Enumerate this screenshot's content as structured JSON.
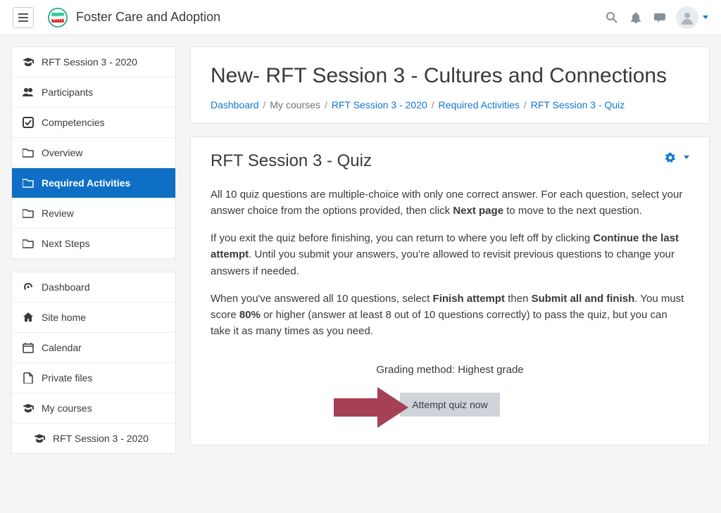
{
  "site_title": "Foster Care and Adoption",
  "sidebar": {
    "course_items": [
      {
        "icon": "grad-cap",
        "label": "RFT Session 3 - 2020",
        "active": false
      },
      {
        "icon": "users",
        "label": "Participants",
        "active": false
      },
      {
        "icon": "check-square",
        "label": "Competencies",
        "active": false
      },
      {
        "icon": "folder",
        "label": "Overview",
        "active": false
      },
      {
        "icon": "folder",
        "label": "Required Activities",
        "active": true
      },
      {
        "icon": "folder",
        "label": "Review",
        "active": false
      },
      {
        "icon": "folder",
        "label": "Next Steps",
        "active": false
      }
    ],
    "nav_items": [
      {
        "icon": "gauge",
        "label": "Dashboard"
      },
      {
        "icon": "home",
        "label": "Site home"
      },
      {
        "icon": "calendar",
        "label": "Calendar"
      },
      {
        "icon": "file",
        "label": "Private files"
      },
      {
        "icon": "grad-cap",
        "label": "My courses"
      },
      {
        "icon": "grad-cap",
        "label": "RFT Session 3 - 2020",
        "indent": true
      }
    ]
  },
  "header": {
    "title": "New- RFT Session 3 - Cultures and Connections",
    "breadcrumb": [
      {
        "label": "Dashboard",
        "link": true
      },
      {
        "label": "My courses",
        "link": false
      },
      {
        "label": "RFT Session 3 - 2020",
        "link": true
      },
      {
        "label": "Required Activities",
        "link": true
      },
      {
        "label": "RFT Session 3 - Quiz",
        "link": true
      }
    ]
  },
  "quiz": {
    "title": "RFT Session 3 - Quiz",
    "p1_a": "All 10 quiz questions are multiple-choice with only one correct answer. For each question, select your answer choice from the options provided, then click ",
    "p1_b": "Next page",
    "p1_c": " to move to the next question.",
    "p2_a": "If you exit the quiz before finishing, you can return to where you left off by clicking ",
    "p2_b": "Continue the last attempt",
    "p2_c": ". Until you submit your answers, you're allowed to revisit previous questions to change your answers if needed.",
    "p3_a": "When you've answered all 10 questions, select ",
    "p3_b": "Finish attempt",
    "p3_c": " then ",
    "p3_d": "Submit all and finish",
    "p3_e": ". You must score ",
    "p3_f": "80%",
    "p3_g": " or higher (answer at least 8 out of 10 questions correctly) to pass the quiz, but you can take it as many times as you need.",
    "grading": "Grading method: Highest grade",
    "attempt_button": "Attempt quiz now"
  }
}
